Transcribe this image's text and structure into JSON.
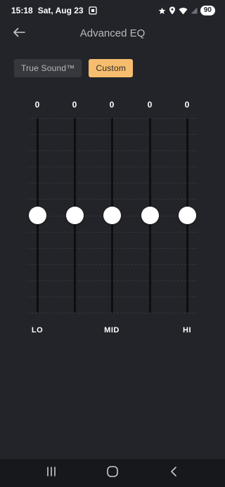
{
  "status_bar": {
    "time": "15:18",
    "date": "Sat, Aug 23",
    "battery": "90",
    "icons": [
      "screenshot-icon",
      "star-icon",
      "location-icon",
      "wifi-icon",
      "signal-icon"
    ]
  },
  "header": {
    "title": "Advanced EQ",
    "back_icon": "arrow-left-icon"
  },
  "presets": [
    {
      "label": "True Sound™",
      "active": false
    },
    {
      "label": "Custom",
      "active": true
    }
  ],
  "eq": {
    "bands": [
      {
        "value": "0",
        "gain": 0
      },
      {
        "value": "0",
        "gain": 0
      },
      {
        "value": "0",
        "gain": 0
      },
      {
        "value": "0",
        "gain": 0
      },
      {
        "value": "0",
        "gain": 0
      }
    ],
    "labels": {
      "low": "LO",
      "mid": "MID",
      "high": "HI"
    }
  },
  "nav_bar": {
    "icons": [
      "recent-apps-icon",
      "home-icon",
      "back-chevron-icon"
    ]
  },
  "colors": {
    "background": "#232429",
    "accent": "#f6bd6e",
    "track": "#0d0e10",
    "thumb": "#ffffff"
  }
}
